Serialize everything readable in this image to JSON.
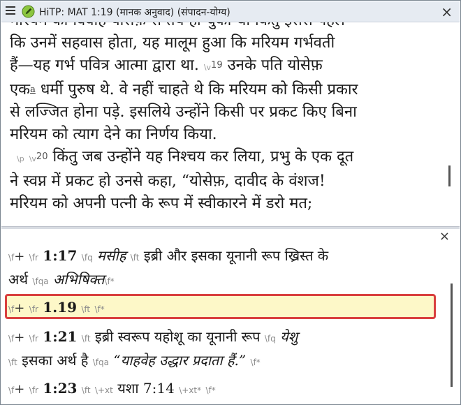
{
  "window": {
    "title": "HiTP: MAT 1:19 (मानक अनुवाद) (संपादन-योग्य)",
    "close": "×"
  },
  "editor": {
    "line0": "मरियम का विवाह योसेफ़ से तय हो चुका था किंतु इससे पहले",
    "line1": "कि उनमें सहवास होता, यह मालूम हुआ कि मरियम गर्भवती",
    "line2a": "हैं—यह गर्भ पवित्र आत्मा द्वारा था.",
    "line2marker": "\\v",
    "line2num": "19",
    "line2b": "उनके पति योसेफ़",
    "line3a": "एक",
    "line3fn": "a",
    "line3b": "धर्मी पुरुष थे. वे नहीं चाहते थे कि मरियम को किसी प्रकार",
    "line4": "से लज्जित होना पड़े. इसलिये उन्होंने किसी पर प्रकट किए बिना",
    "line5": "मरियम को त्याग देने का निर्णय किया.",
    "line6marker": "\\p",
    "line6vmarker": "\\v",
    "line6num": "20",
    "line6b": "किंतु जब उन्होंने यह निश्चय कर लिया, प्रभु के एक दूत",
    "line7": "ने स्वप्न में प्रकट हो उनसे कहा, “योसेफ़, दावीद के वंशज!",
    "line8": "मरियम को अपनी पत्नी के रूप में स्वीकारने में डरो मत;"
  },
  "notes": {
    "close": "×",
    "items": [
      {
        "f": "\\f",
        "plus": "+",
        "fr": "\\fr",
        "ref": "1:17",
        "fq": "\\fq",
        "quote": "मसीह",
        "ft": "\\ft",
        "text": "इब्री और इसका यूनानी रूप ख्रिस्त के",
        "text2": "अर्थ",
        "fqa": "\\fqa",
        "alt": "अभिषिक्त",
        "end": "\\f*"
      },
      {
        "f": "\\f",
        "plus": "+",
        "fr": "\\fr",
        "ref": "1.19",
        "ft": "\\ft",
        "end": "\\f*"
      },
      {
        "f": "\\f",
        "plus": "+",
        "fr": "\\fr",
        "ref": "1:21",
        "ft": "\\ft",
        "text": "इब्री स्वरूप यहोशू का यूनानी रूप",
        "fq": "\\fq",
        "quote": "येशु",
        "ft2": "\\ft",
        "text2": "इसका अर्थ है",
        "fqa": "\\fqa",
        "alt": "“याहवेह उद्धार प्रदाता हैं.”",
        "end": "\\f*"
      },
      {
        "f": "\\f",
        "plus": "+",
        "fr": "\\fr",
        "ref": "1:23",
        "ft": "\\ft",
        "xt": "\\+xt",
        "text": "यशा 7:14",
        "xtend": "\\+xt*",
        "end": "\\f*"
      }
    ]
  },
  "colors": {
    "highlight_border": "#d9403f",
    "highlight_fill": "#fdf8c8",
    "titlebar": "#e6ebf2"
  }
}
